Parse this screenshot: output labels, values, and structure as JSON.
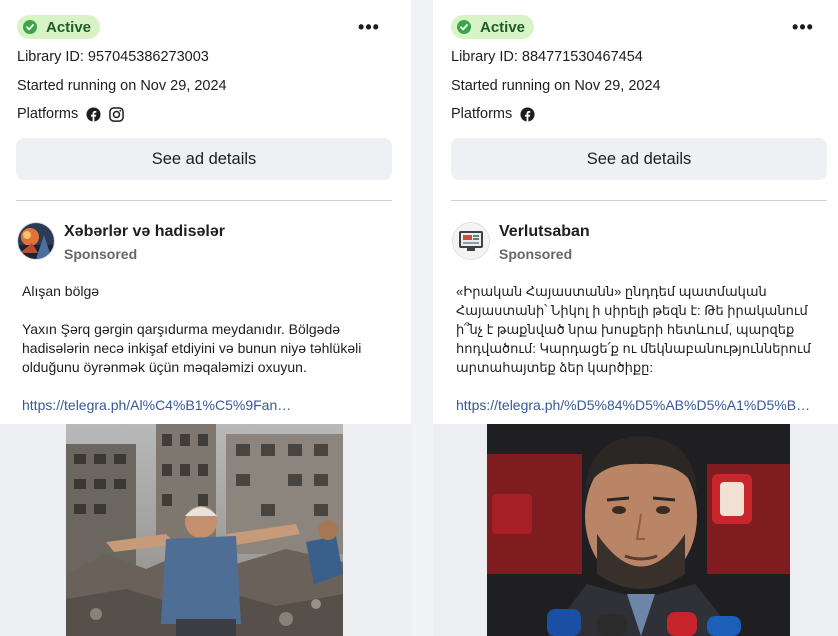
{
  "cards": [
    {
      "status": "Active",
      "library_id": "Library ID: 957045386273003",
      "started": "Started running on Nov 29, 2024",
      "platforms_label": "Platforms",
      "platform_icons": [
        "facebook-icon",
        "instagram-icon"
      ],
      "see_details": "See ad details",
      "page_name": "Xəbərlər və hadisələr",
      "sponsored": "Sponsored",
      "body_title": "Alışan bölgə",
      "body_text": "Yaxın Şərq gərgin qarşıdurma meydanıdır. Bölgədə hadisələrin necə inkişaf etdiyini və bunun niyə təhlükəli olduğunu öyrənmək üçün məqaləmizi oxuyun.",
      "link": "https://telegra.ph/Al%C4%B1%C5%9Fan-..."
    },
    {
      "status": "Active",
      "library_id": "Library ID: 884771530467454",
      "started": "Started running on Nov 29, 2024",
      "platforms_label": "Platforms",
      "platform_icons": [
        "facebook-icon"
      ],
      "see_details": "See ad details",
      "page_name": "Verlutsaban",
      "sponsored": "Sponsored",
      "body_text": "«Իրական Հայաստանն» ընդդեմ պատմական Հայաստանի՝ Նիկոլ ի սիրելի թեզն է: Թե իրականում ի՞նչ է թաքնված նրա խոսքերի հետևում, պարզեք հոդվածում: Կարդացե՛ք ու մեկնաբանություններում արտահայտեք ձեր կարծիքը:",
      "link": "https://telegra.ph/%D5%84%D5%AB%D5%A1%D5%BA%..."
    }
  ],
  "colors": {
    "active_bg": "#d8f3c6",
    "active_check": "#39a64a",
    "link": "#385898",
    "button_bg": "#eef0f3"
  }
}
